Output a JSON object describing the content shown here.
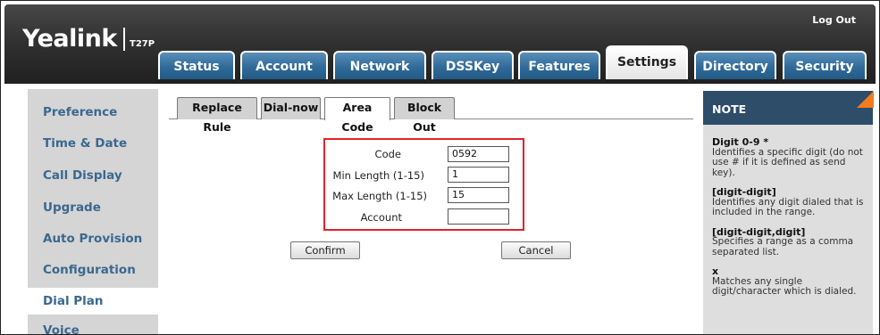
{
  "header": {
    "logo": "Yealink",
    "model": "T27P",
    "logout": "Log Out",
    "tabs": [
      "Status",
      "Account",
      "Network",
      "DSSKey",
      "Features",
      "Settings",
      "Directory",
      "Security"
    ],
    "active_tab": "Settings"
  },
  "sidebar": {
    "items": [
      "Preference",
      "Time & Date",
      "Call Display",
      "Upgrade",
      "Auto Provision",
      "Configuration",
      "Dial Plan",
      "Voice"
    ],
    "active_item": "Dial Plan"
  },
  "subtabs": {
    "items": [
      "Replace Rule",
      "Dial-now",
      "Area Code",
      "Block Out"
    ],
    "active": "Area Code"
  },
  "form": {
    "code_label": "Code",
    "code_value": "0592",
    "min_label": "Min Length (1-15)",
    "min_value": "1",
    "max_label": "Max Length (1-15)",
    "max_value": "15",
    "account_label": "Account",
    "account_value": "",
    "confirm": "Confirm",
    "cancel": "Cancel"
  },
  "note": {
    "title": "NOTE",
    "entries": [
      {
        "term": "Digit 0-9 *",
        "desc": "Identifies a specific digit (do not use # if it is defined as send key)."
      },
      {
        "term": "[digit-digit]",
        "desc": "Identifies any digit dialed that is included in the range."
      },
      {
        "term": "[digit-digit,digit]",
        "desc": "Specifies a range as a comma separated list."
      },
      {
        "term": "x",
        "desc": "Matches any single digit/character which is dialed."
      }
    ]
  },
  "colors": {
    "header_dark": "#323232",
    "tab_blue": "#2f6a99",
    "sidebar_bg": "#d5d5d5",
    "sidebar_text": "#3a6890",
    "highlight_box": "#e0232c",
    "note_head": "#2e4d69",
    "note_accent": "#f27c1f"
  }
}
